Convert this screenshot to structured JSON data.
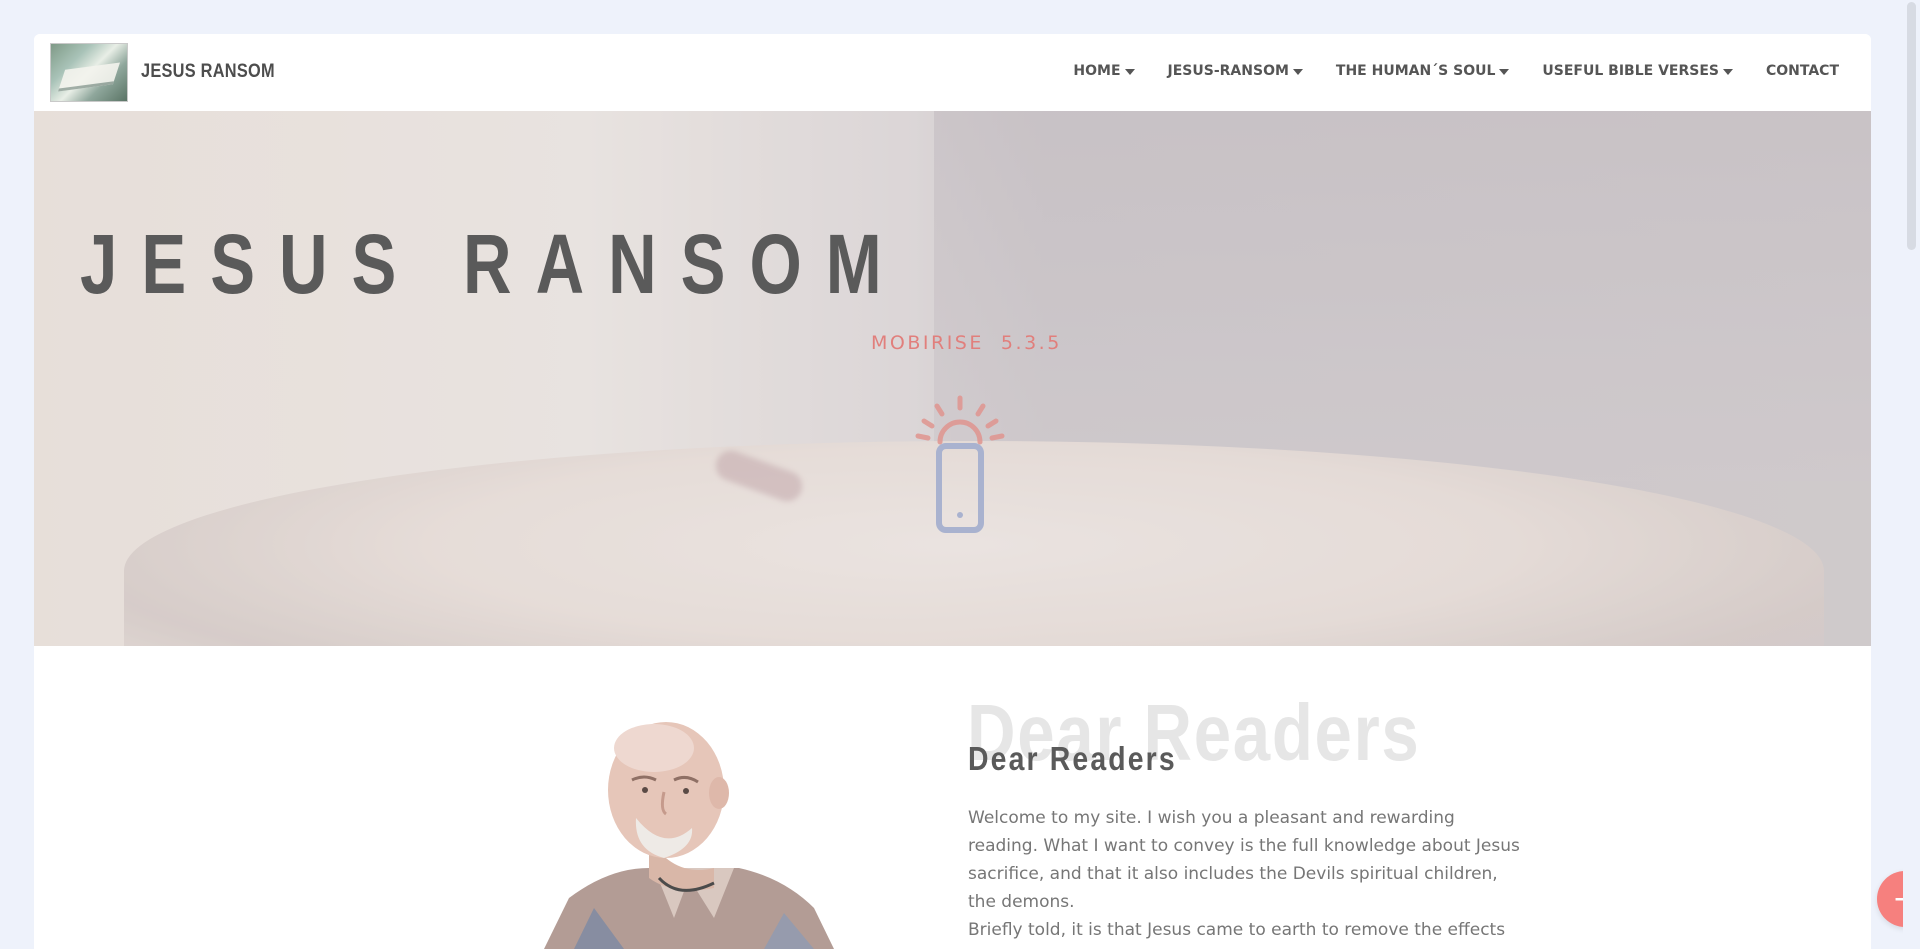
{
  "header": {
    "brand": "JESUS RANSOM",
    "nav": [
      {
        "label": "HOME",
        "dropdown": true
      },
      {
        "label": "JESUS-RANSOM",
        "dropdown": true
      },
      {
        "label": "THE HUMAN´S SOUL",
        "dropdown": true
      },
      {
        "label": "USEFUL BIBLE VERSES",
        "dropdown": true
      },
      {
        "label": "CONTACT",
        "dropdown": false
      }
    ]
  },
  "hero": {
    "title": "JESUS RANSOM",
    "loader_text": "MOBIRISE  5.3.5",
    "loader_icon": "phone-notification-icon"
  },
  "content": {
    "ghost_heading": "Dear Readers",
    "heading": "Dear Readers",
    "paragraphs": [
      "Welcome to my site. I wish you a pleasant and rewarding reading. What I want to convey is the full knowledge about Jesus sacrifice, and that it also includes the Devils spiritual children, the demons.",
      "Briefly told, it is that Jesus came to earth to remove the effects"
    ]
  },
  "fab": {
    "icon": "plus-icon",
    "label": "+"
  },
  "colors": {
    "accent": "#f6807e",
    "text_dark": "#5a5a5a",
    "text_body": "#767676",
    "background": "#eef2fb"
  }
}
